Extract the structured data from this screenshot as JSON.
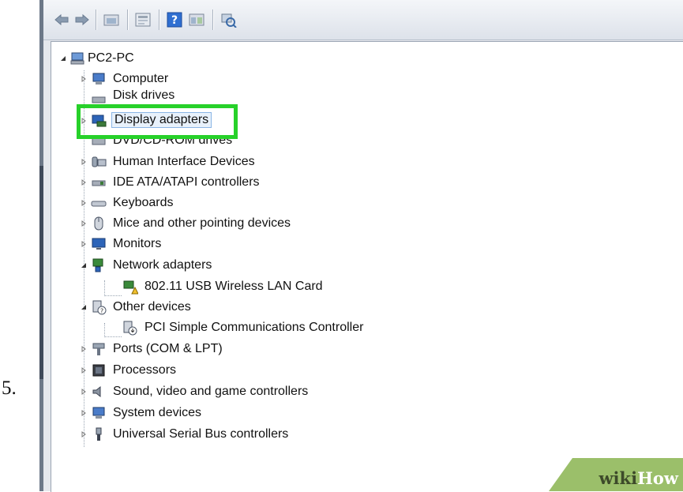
{
  "step_number": "5.",
  "tree": {
    "root": {
      "label": "PC2-PC",
      "expanded": true,
      "icon": "computer-icon"
    },
    "items": [
      {
        "label": "Computer",
        "icon": "computer-icon",
        "expanded": false
      },
      {
        "label": "Disk drives",
        "icon": "disk-drive-icon",
        "expanded": false
      },
      {
        "label": "Display adapters",
        "icon": "display-adapter-icon",
        "expanded": false,
        "highlighted": true
      },
      {
        "label": "DVD/CD-ROM drives",
        "icon": "dvd-drive-icon",
        "expanded": false
      },
      {
        "label": "Human Interface Devices",
        "icon": "hid-icon",
        "expanded": false
      },
      {
        "label": "IDE ATA/ATAPI controllers",
        "icon": "ide-controller-icon",
        "expanded": false
      },
      {
        "label": "Keyboards",
        "icon": "keyboard-icon",
        "expanded": false
      },
      {
        "label": "Mice and other pointing devices",
        "icon": "mouse-icon",
        "expanded": false
      },
      {
        "label": "Monitors",
        "icon": "monitor-icon",
        "expanded": false
      },
      {
        "label": "Network adapters",
        "icon": "network-adapter-icon",
        "expanded": true,
        "children": [
          {
            "label": "802.11 USB Wireless LAN Card",
            "icon": "network-warning-icon"
          }
        ]
      },
      {
        "label": "Other devices",
        "icon": "other-devices-icon",
        "expanded": true,
        "children": [
          {
            "label": "PCI Simple Communications Controller",
            "icon": "unknown-device-icon"
          }
        ]
      },
      {
        "label": "Ports (COM & LPT)",
        "icon": "port-icon",
        "expanded": false
      },
      {
        "label": "Processors",
        "icon": "processor-icon",
        "expanded": false
      },
      {
        "label": "Sound, video and game controllers",
        "icon": "sound-icon",
        "expanded": false
      },
      {
        "label": "System devices",
        "icon": "system-devices-icon",
        "expanded": false
      },
      {
        "label": "Universal Serial Bus controllers",
        "icon": "usb-icon",
        "expanded": false
      }
    ]
  },
  "watermark": {
    "wiki": "wiki",
    "how": "How"
  },
  "colors": {
    "highlight": "#27d12a",
    "window_bg": "#e4e7ec",
    "tree_bg": "#ffffff"
  }
}
